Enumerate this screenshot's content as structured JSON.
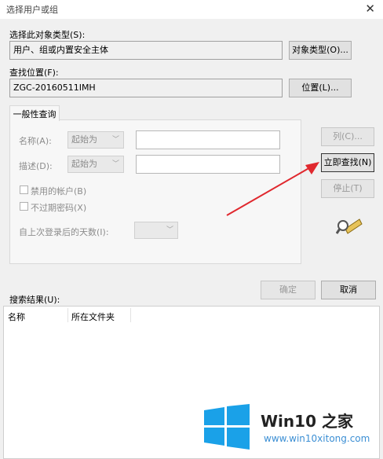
{
  "window": {
    "title": "选择用户或组"
  },
  "object_type": {
    "label": "选择此对象类型(S):",
    "value": "用户、组或内置安全主体",
    "button": "对象类型(O)..."
  },
  "location": {
    "label": "查找位置(F):",
    "value": "ZGC-20160511IMH",
    "button": "位置(L)..."
  },
  "query": {
    "tab": "一般性查询",
    "name_label": "名称(A):",
    "name_mode": "起始为",
    "desc_label": "描述(D):",
    "desc_mode": "起始为",
    "disabled_accounts": "禁用的帐户(B)",
    "non_expiring": "不过期密码(X)",
    "days_label": "自上次登录后的天数(I):"
  },
  "side_buttons": {
    "columns": "列(C)...",
    "find_now": "立即查找(N)",
    "stop": "停止(T)"
  },
  "footer": {
    "ok": "确定",
    "cancel": "取消"
  },
  "results": {
    "label": "搜索结果(U):",
    "columns": [
      "名称",
      "所在文件夹"
    ]
  },
  "watermark": {
    "brand": "Win10 之家",
    "url": "www.win10xitong.com"
  },
  "colors": {
    "arrow": "#e0282e",
    "logo_blue": "#1aa1e8"
  }
}
